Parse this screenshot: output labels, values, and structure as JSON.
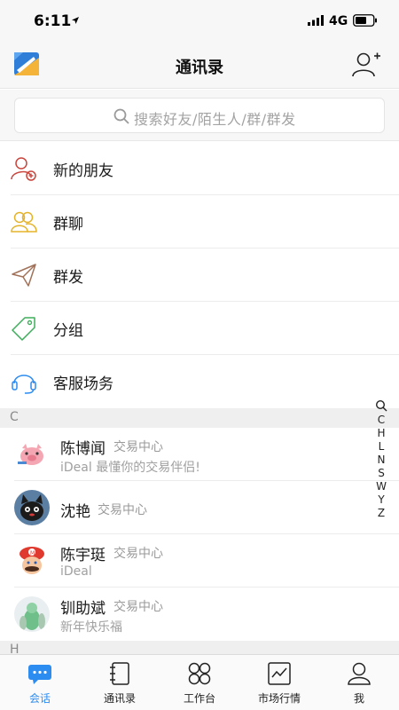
{
  "status_bar": {
    "time": "6:11",
    "network": "4G"
  },
  "nav": {
    "title": "通讯录",
    "logo_icon": "app-logo-icon",
    "add_icon": "add-friend-icon"
  },
  "search": {
    "placeholder": "搜索好友/陌生人/群/群发"
  },
  "functions": [
    {
      "label": "新的朋友",
      "icon": "new-friend-icon",
      "color": "#c9463d"
    },
    {
      "label": "群聊",
      "icon": "group-chat-icon",
      "color": "#e5b32a"
    },
    {
      "label": "群发",
      "icon": "broadcast-icon",
      "color": "#a0725a"
    },
    {
      "label": "分组",
      "icon": "tag-icon",
      "color": "#3fae5c"
    },
    {
      "label": "客服场务",
      "icon": "headset-icon",
      "color": "#2d8cf0"
    }
  ],
  "sections": [
    {
      "letter": "C",
      "contacts": [
        {
          "name": "陈博闻",
          "tag": "交易中心",
          "subtitle": "iDeal 最懂你的交易伴侣!",
          "avatar": "pink-pig-avatar"
        },
        {
          "name": "沈艳",
          "tag": "交易中心",
          "subtitle": "",
          "avatar": "black-cat-avatar"
        },
        {
          "name": "陈宇珽",
          "tag": "交易中心",
          "subtitle": "iDeal",
          "avatar": "mario-avatar"
        },
        {
          "name": "钏助斌",
          "tag": "交易中心",
          "subtitle": "新年快乐福",
          "avatar": "green-figure-avatar"
        }
      ]
    },
    {
      "letter": "H",
      "contacts": []
    }
  ],
  "index_letters": [
    "C",
    "H",
    "L",
    "N",
    "S",
    "W",
    "Y",
    "Z"
  ],
  "tabs": [
    {
      "label": "会话",
      "icon": "chat-icon",
      "active": true
    },
    {
      "label": "通讯录",
      "icon": "contacts-book-icon",
      "active": false
    },
    {
      "label": "工作台",
      "icon": "workbench-icon",
      "active": false
    },
    {
      "label": "市场行情",
      "icon": "market-chart-icon",
      "active": false
    },
    {
      "label": "我",
      "icon": "profile-icon",
      "active": false
    }
  ],
  "colors": {
    "accent": "#2d8cf0",
    "background": "#f7f7f7",
    "section_header": "#efefef"
  }
}
